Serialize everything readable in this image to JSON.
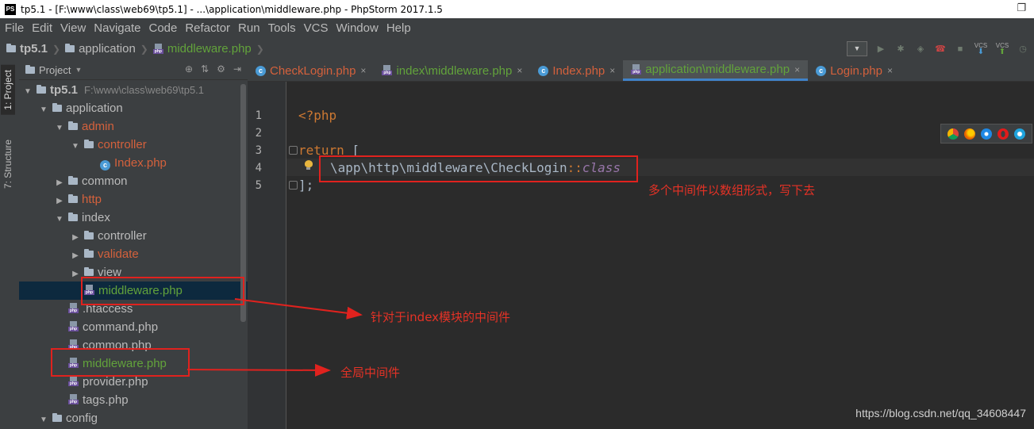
{
  "window": {
    "title": "tp5.1 - [F:\\www\\class\\web69\\tp5.1] - ...\\application\\middleware.php - PhpStorm 2017.1.5",
    "logo_text": "PS",
    "restore_glyph": "❐"
  },
  "menu": [
    "File",
    "Edit",
    "View",
    "Navigate",
    "Code",
    "Refactor",
    "Run",
    "Tools",
    "VCS",
    "Window",
    "Help"
  ],
  "breadcrumb": {
    "project": "tp5.1",
    "folder": "application",
    "file": "middleware.php"
  },
  "toolbar": {
    "vcs1": "VCS",
    "vcs2": "VCS"
  },
  "left_strip": {
    "project_tab": "1: Project",
    "structure_tab": "7: Structure"
  },
  "project_panel": {
    "title": "Project",
    "root": {
      "name": "tp5.1",
      "path": "F:\\www\\class\\web69\\tp5.1"
    },
    "tree": [
      {
        "label": "application",
        "level": 1,
        "icon": "folder",
        "toggle": "open",
        "color": "normal"
      },
      {
        "label": "admin",
        "level": 2,
        "icon": "folder",
        "toggle": "open",
        "color": "red"
      },
      {
        "label": "controller",
        "level": 3,
        "icon": "folder",
        "toggle": "open",
        "color": "red"
      },
      {
        "label": "Index.php",
        "level": 4,
        "icon": "class",
        "toggle": "none",
        "color": "red"
      },
      {
        "label": "common",
        "level": 2,
        "icon": "folder",
        "toggle": "closed",
        "color": "normal"
      },
      {
        "label": "http",
        "level": 2,
        "icon": "folder",
        "toggle": "closed",
        "color": "red"
      },
      {
        "label": "index",
        "level": 2,
        "icon": "folder",
        "toggle": "open",
        "color": "normal"
      },
      {
        "label": "controller",
        "level": 3,
        "icon": "folder",
        "toggle": "closed",
        "color": "normal"
      },
      {
        "label": "validate",
        "level": 3,
        "icon": "folder",
        "toggle": "closed",
        "color": "red"
      },
      {
        "label": "view",
        "level": 3,
        "icon": "folder",
        "toggle": "closed",
        "color": "normal"
      },
      {
        "label": "middleware.php",
        "level": 3,
        "icon": "php",
        "toggle": "none",
        "color": "green",
        "selected": true
      },
      {
        "label": ".htaccess",
        "level": 2,
        "icon": "php",
        "toggle": "none",
        "color": "normal"
      },
      {
        "label": "command.php",
        "level": 2,
        "icon": "php",
        "toggle": "none",
        "color": "normal"
      },
      {
        "label": "common.php",
        "level": 2,
        "icon": "php",
        "toggle": "none",
        "color": "normal"
      },
      {
        "label": "middleware.php",
        "level": 2,
        "icon": "php",
        "toggle": "none",
        "color": "green"
      },
      {
        "label": "provider.php",
        "level": 2,
        "icon": "php",
        "toggle": "none",
        "color": "normal"
      },
      {
        "label": "tags.php",
        "level": 2,
        "icon": "php",
        "toggle": "none",
        "color": "normal"
      },
      {
        "label": "config",
        "level": 1,
        "icon": "folder",
        "toggle": "open",
        "color": "normal"
      }
    ]
  },
  "tabs": [
    {
      "label": "CheckLogin.php",
      "icon": "class",
      "color": "red",
      "active": false
    },
    {
      "label": "index\\middleware.php",
      "icon": "php",
      "color": "green",
      "active": false
    },
    {
      "label": "Index.php",
      "icon": "class",
      "color": "red",
      "active": false
    },
    {
      "label": "application\\middleware.php",
      "icon": "php",
      "color": "green",
      "active": true
    },
    {
      "label": "Login.php",
      "icon": "class",
      "color": "red",
      "active": false
    }
  ],
  "tab_close_glyph": "×",
  "editor": {
    "line_numbers": [
      "1",
      "2",
      "3",
      "4",
      "5"
    ],
    "line1": "<?php",
    "line3_kw": "return",
    "line3_br": " [",
    "line4_path": "\\app\\http\\middleware\\CheckLogin",
    "line4_dcolon": "::",
    "line4_class": "class",
    "line5": "];"
  },
  "annotations": {
    "array_note": "多个中间件以数组形式，写下去",
    "module_note": "针对于index模块的中间件",
    "global_note": "全局中间件"
  },
  "browser_icons": [
    "chrome-icon",
    "firefox-icon",
    "safari-icon",
    "opera-icon",
    "ie-icon"
  ],
  "watermark": "https://blog.csdn.net/qq_34608447",
  "colors": {
    "accent_red": "#e0221e",
    "php_keyword": "#cc7832",
    "vcs_red": "#d4613c",
    "vcs_green": "#62a33b"
  }
}
